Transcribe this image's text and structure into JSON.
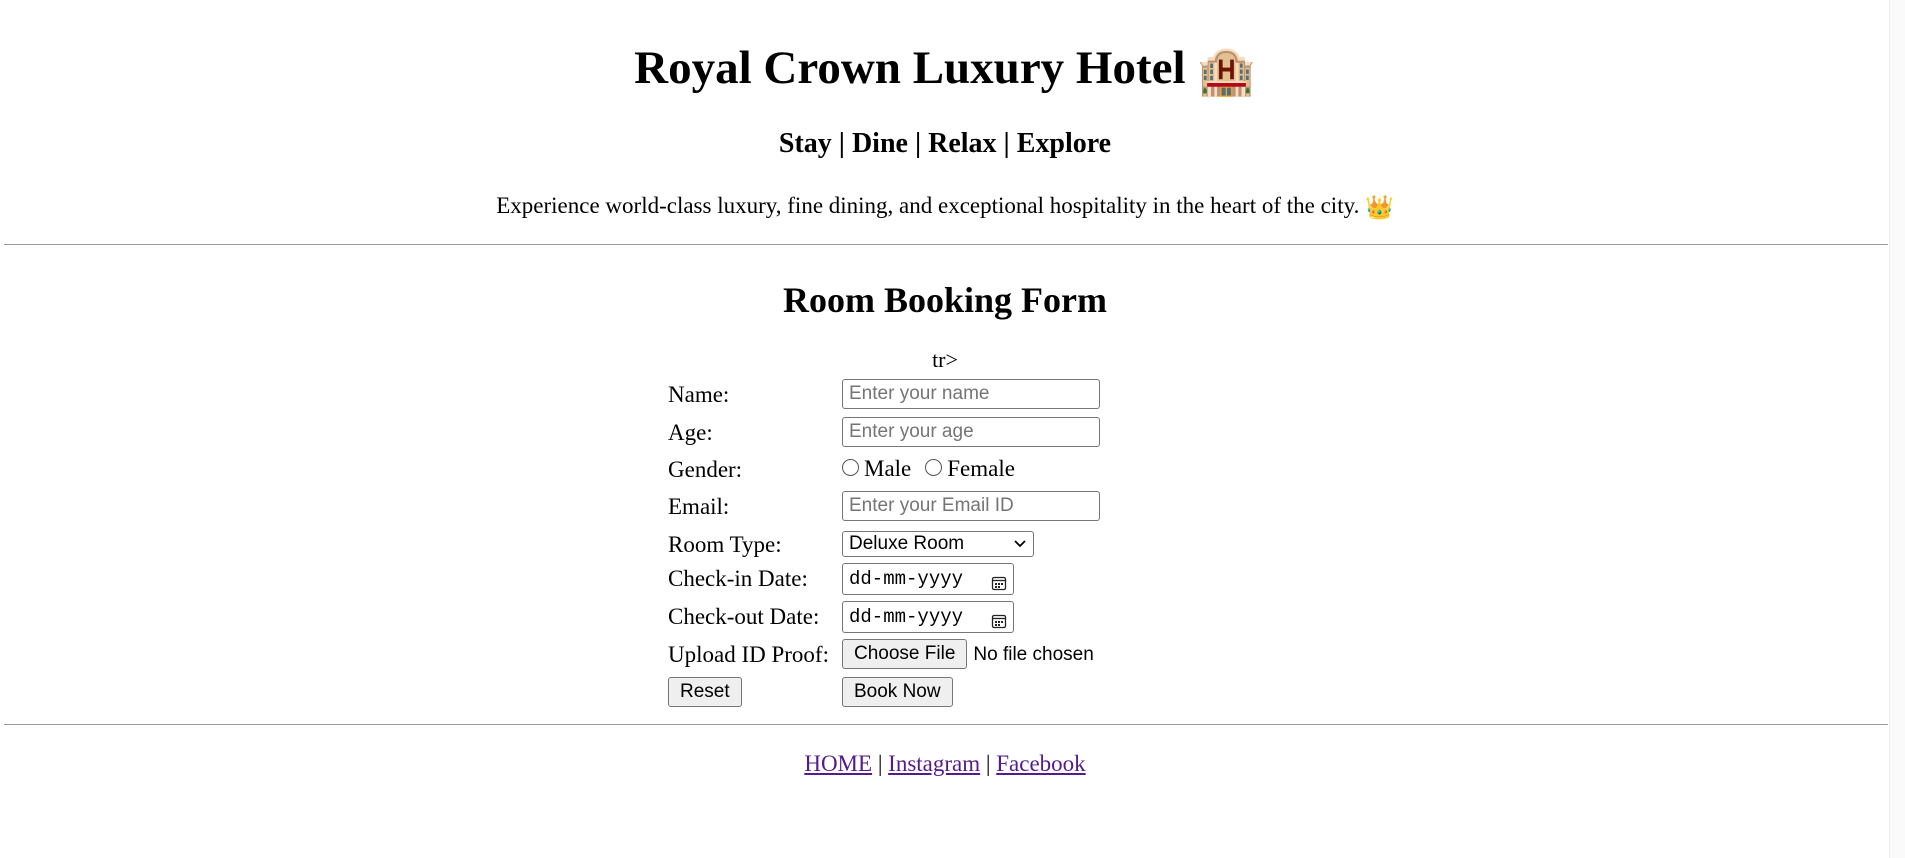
{
  "header": {
    "title": "Royal Crown Luxury Hotel",
    "title_emoji": "🏨",
    "tagline": "Stay | Dine | Relax | Explore",
    "intro": "Experience world-class luxury, fine dining, and exceptional hospitality in the heart of the city.",
    "intro_emoji": "👑"
  },
  "form": {
    "title": "Room Booking Form",
    "stray_text": "tr>",
    "name": {
      "label": "Name:",
      "placeholder": "Enter your name",
      "value": ""
    },
    "age": {
      "label": "Age:",
      "placeholder": "Enter your age",
      "value": ""
    },
    "gender": {
      "label": "Gender:",
      "options": [
        "Male",
        "Female"
      ],
      "selected": null
    },
    "email": {
      "label": "Email:",
      "placeholder": "Enter your Email ID",
      "value": ""
    },
    "room_type": {
      "label": "Room Type:",
      "selected": "Deluxe Room"
    },
    "checkin": {
      "label": "Check-in Date:",
      "placeholder": "dd-mm-yyyy"
    },
    "checkout": {
      "label": "Check-out Date:",
      "placeholder": "dd-mm-yyyy"
    },
    "upload": {
      "label": "Upload ID Proof:",
      "button": "Choose File",
      "status": "No file chosen"
    },
    "reset_label": "Reset",
    "submit_label": "Book Now"
  },
  "footer": {
    "links": [
      "HOME",
      "Instagram",
      "Facebook"
    ],
    "separator": "|"
  },
  "colors": {
    "link_visited": "#551a8b",
    "divider": "#9a9a9a",
    "button_bg": "#efefef"
  },
  "icons": {
    "hotel": "hotel-icon",
    "crown": "crown-icon",
    "calendar": "calendar-icon",
    "select_arrow": "chevron-down-icon"
  }
}
